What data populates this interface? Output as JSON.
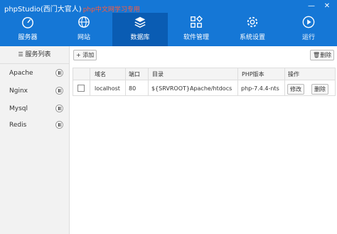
{
  "window": {
    "title": "phpStudio(西门大官人)",
    "brand": "php中文网学习专用",
    "controls": {
      "minimize": "—",
      "close": "✕"
    }
  },
  "tabs": [
    {
      "label": "服务器",
      "icon": "dashboard-icon"
    },
    {
      "label": "网站",
      "icon": "globe-icon"
    },
    {
      "label": "数据库",
      "icon": "database-layers-icon"
    },
    {
      "label": "软件管理",
      "icon": "apps-grid-icon"
    },
    {
      "label": "系统设置",
      "icon": "gear-icon"
    },
    {
      "label": "运行",
      "icon": "play-icon"
    }
  ],
  "sidebar": {
    "header": "服务列表",
    "items": [
      {
        "name": "Apache"
      },
      {
        "name": "Nginx"
      },
      {
        "name": "Mysql"
      },
      {
        "name": "Redis"
      }
    ]
  },
  "toolbar": {
    "add_label": "添加",
    "delete_label": "删除"
  },
  "table": {
    "headers": [
      "域名",
      "端口",
      "目录",
      "PHP版本",
      "操作"
    ],
    "rows": [
      {
        "domain": "localhost",
        "port": "80",
        "dir": "${SRVROOT}Apache/htdocs",
        "php": "php-7.4.4-nts",
        "edit": "修改",
        "del": "删除"
      }
    ]
  },
  "colors": {
    "topbar": "#1577d6",
    "active_tab": "#0a5cb3",
    "brand": "#ff5a3c"
  }
}
